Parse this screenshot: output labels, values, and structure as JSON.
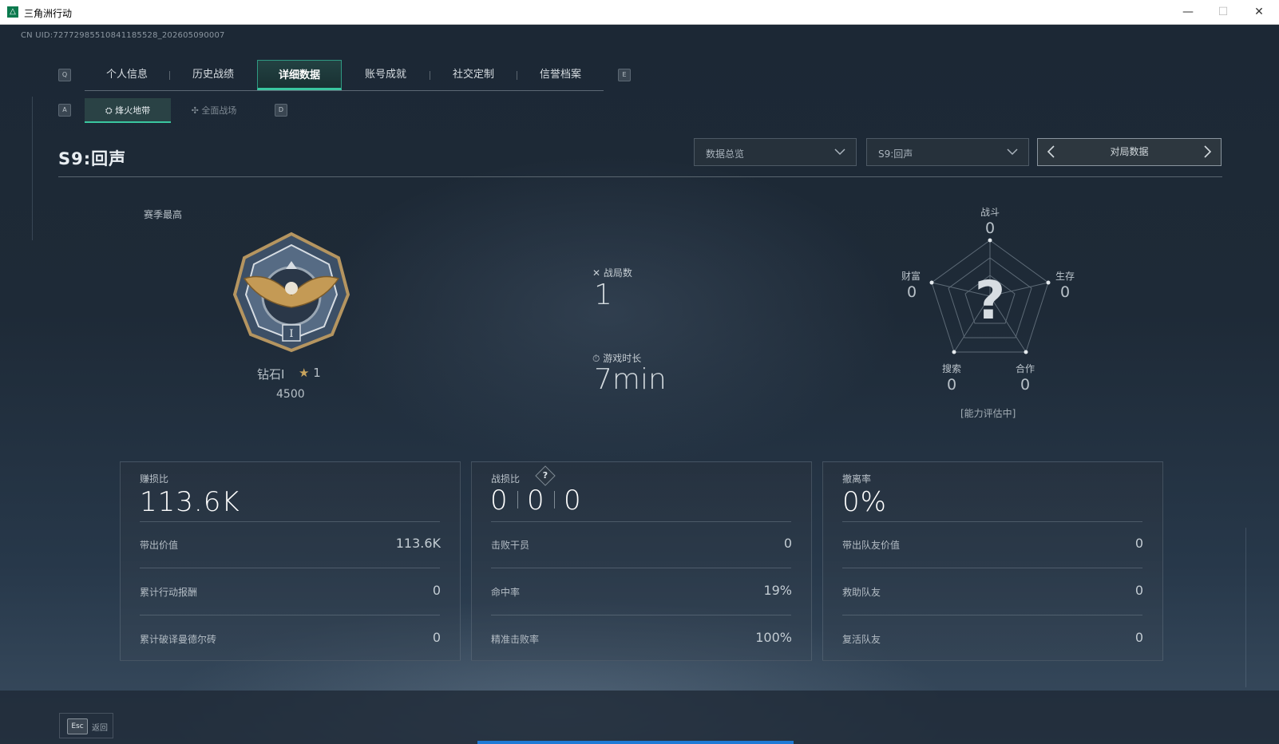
{
  "window": {
    "title": "三角洲行动",
    "app_icon": "delta-logo-icon"
  },
  "uid_text": "CN UID:72772985510841185528_202605090007",
  "nav": {
    "prev_key": "Q",
    "next_key": "E",
    "tabs": [
      "个人信息",
      "历史战绩",
      "详细数据",
      "账号成就",
      "社交定制",
      "信誉档案"
    ],
    "active_tab": "详细数据"
  },
  "subnav": {
    "prev_key": "A",
    "next_key": "D",
    "tabs": [
      "烽火地带",
      "全面战场"
    ],
    "active_tab": "烽火地带"
  },
  "season_title": "S9:回声",
  "filters": {
    "dropdown1": "数据总览",
    "dropdown2": "S9:回声",
    "pager_label": "对局数据"
  },
  "rank": {
    "label": "赛季最高",
    "name": "钻石I",
    "stars": "1",
    "score": "4500"
  },
  "match_stats": {
    "matches_label": "战局数",
    "matches_value": "1",
    "playtime_label": "游戏时长",
    "playtime_value": "7min"
  },
  "radar": {
    "axes": [
      {
        "label": "战斗",
        "value": "0"
      },
      {
        "label": "生存",
        "value": "0"
      },
      {
        "label": "合作",
        "value": "0"
      },
      {
        "label": "搜索",
        "value": "0"
      },
      {
        "label": "财富",
        "value": "0"
      }
    ],
    "center_mark": "?",
    "status": "[能力评估中]"
  },
  "cards": [
    {
      "label": "赚损比",
      "value": "113.6K",
      "rows": [
        {
          "label": "带出价值",
          "value": "113.6K"
        },
        {
          "label": "累计行动报酬",
          "value": "0"
        },
        {
          "label": "累计破译曼德尔砖",
          "value": "0"
        }
      ]
    },
    {
      "label": "战损比",
      "help": "?",
      "kd_values": [
        "0",
        "0",
        "0"
      ],
      "rows": [
        {
          "label": "击败干员",
          "value": "0"
        },
        {
          "label": "命中率",
          "value": "19%"
        },
        {
          "label": "精准击败率",
          "value": "100%"
        }
      ]
    },
    {
      "label": "撤离率",
      "value": "0%",
      "rows": [
        {
          "label": "带出队友价值",
          "value": "0"
        },
        {
          "label": "救助队友",
          "value": "0"
        },
        {
          "label": "复活队友",
          "value": "0"
        }
      ]
    }
  ],
  "footer": {
    "esc_key": "Esc",
    "esc_label": "返回"
  },
  "colors": {
    "accent": "#3ac7a0",
    "progress": "#1f7ad6",
    "background": "#1c2835"
  }
}
